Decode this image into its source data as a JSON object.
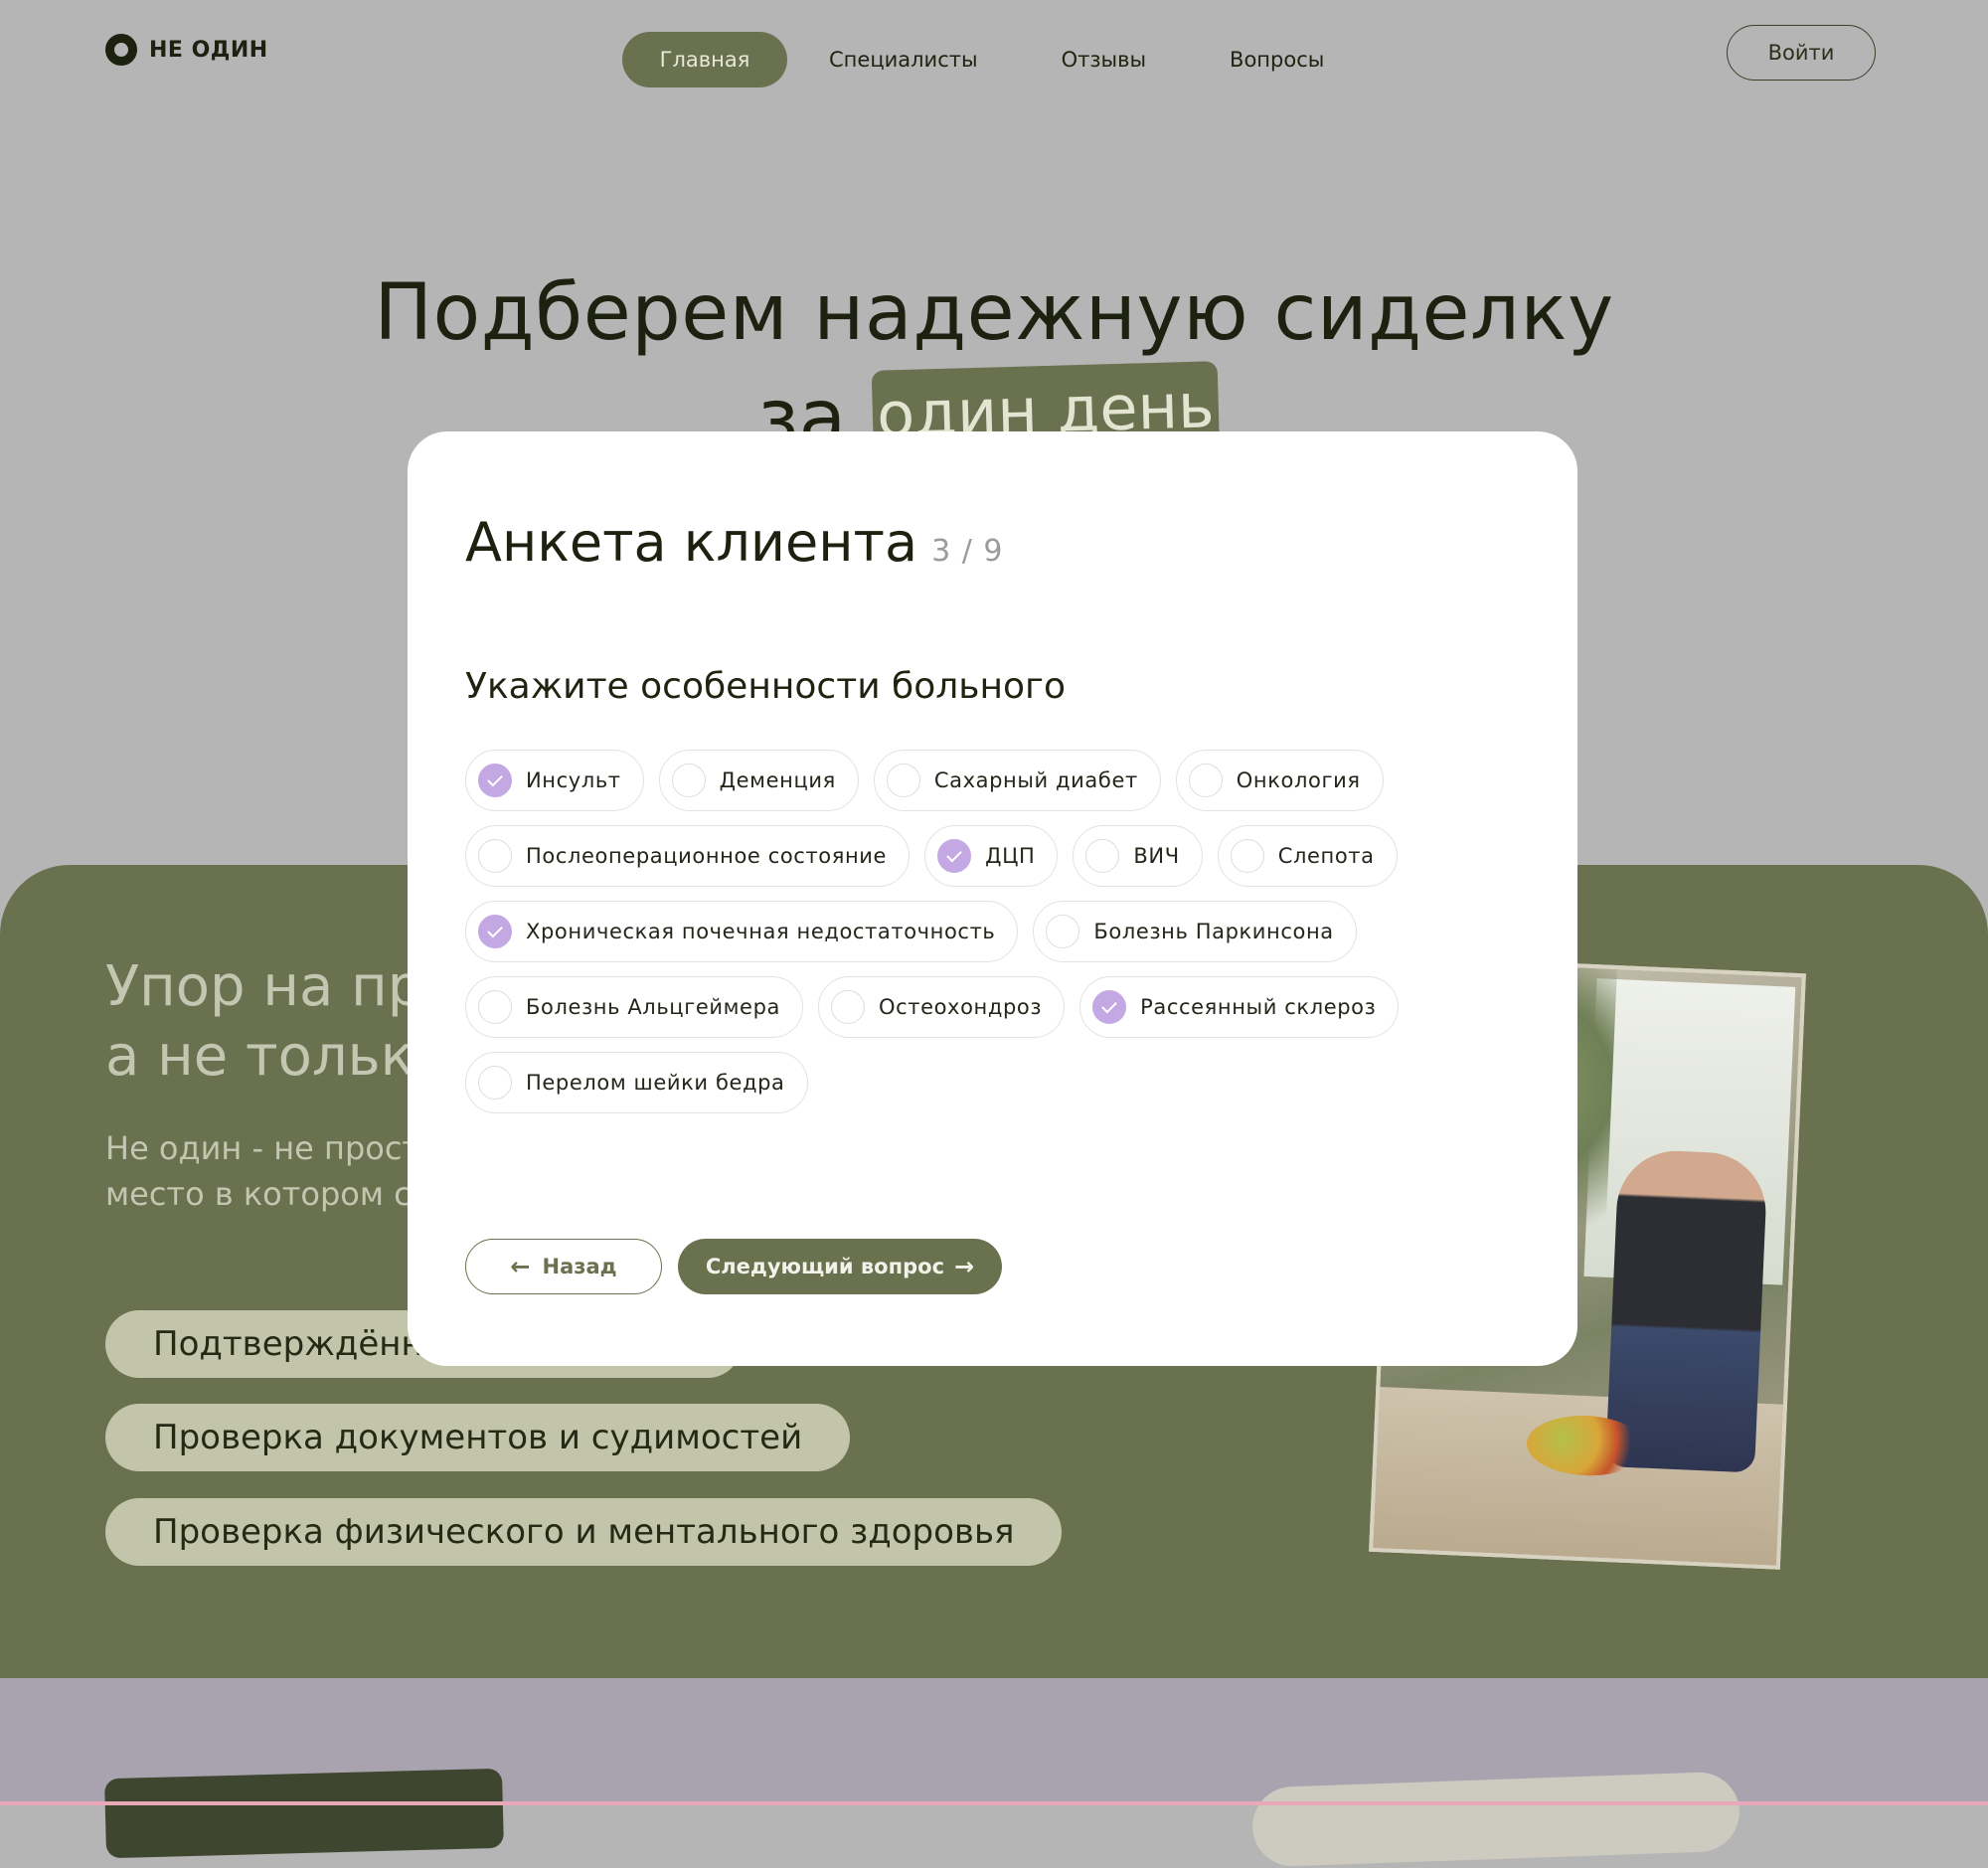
{
  "header": {
    "logo_text": "НЕ ОДИН",
    "nav": [
      "Главная",
      "Специалисты",
      "Отзывы",
      "Вопросы"
    ],
    "active_nav": "Главная",
    "login_label": "Войти"
  },
  "hero": {
    "title_line1": "Подберем надежную сиделку",
    "title_za": "за",
    "title_tag": "один день"
  },
  "green_section": {
    "title": "Упор на пр\nа не только",
    "text": "Не один - не просто\nместо в котором сп",
    "features": [
      "Подтверждённы",
      "Проверка документов и судимостей",
      "Проверка физического и ментального здоровья"
    ]
  },
  "modal": {
    "title": "Анкета клиента",
    "step": "3 / 9",
    "question": "Укажите особенности больного",
    "options": [
      [
        {
          "label": "Инсульт",
          "checked": true
        },
        {
          "label": "Деменция",
          "checked": false
        },
        {
          "label": "Сахарный диабет",
          "checked": false
        },
        {
          "label": "Онкология",
          "checked": false
        }
      ],
      [
        {
          "label": "Послеоперационное состояние",
          "checked": false
        },
        {
          "label": "ДЦП",
          "checked": true
        },
        {
          "label": "ВИЧ",
          "checked": false
        },
        {
          "label": "Слепота",
          "checked": false
        }
      ],
      [
        {
          "label": "Хроническая почечная недостаточность",
          "checked": true
        },
        {
          "label": "Болезнь Паркинсона",
          "checked": false
        }
      ],
      [
        {
          "label": "Болезнь Альцгеймера",
          "checked": false
        },
        {
          "label": "Остеохондроз",
          "checked": false
        },
        {
          "label": "Рассеянный склероз",
          "checked": true
        }
      ],
      [
        {
          "label": "Перелом шейки бедра",
          "checked": false
        }
      ]
    ],
    "back_label": "Назад",
    "next_label": "Следующий вопрос"
  },
  "colors": {
    "accent": "#6a714f",
    "check": "#c4a8e4",
    "overlay": "#b5b5b5",
    "lavender": "#a9a3b0"
  },
  "icons": [
    "logo-ring-icon",
    "arrow-left-icon",
    "arrow-right-icon",
    "check-icon"
  ]
}
